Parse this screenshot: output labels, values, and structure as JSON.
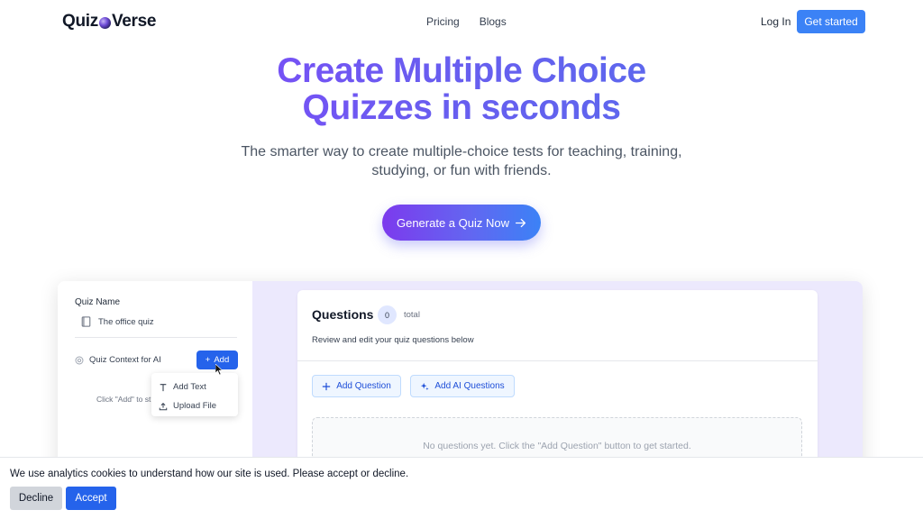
{
  "header": {
    "logo_part1": "Quiz",
    "logo_part2": "Verse",
    "nav": [
      "Pricing",
      "Blogs"
    ],
    "login": "Log In",
    "get_started": "Get started"
  },
  "hero": {
    "title_line1": "Create Multiple Choice",
    "title_line2": "Quizzes in seconds",
    "subtitle_line1": "The smarter way to create multiple-choice tests for teaching, training,",
    "subtitle_line2": "studying, or fun with friends.",
    "cta": "Generate a Quiz Now"
  },
  "preview": {
    "quiz_name_label": "Quiz Name",
    "quiz_name_value": "The office quiz",
    "context_label": "Quiz Context for AI",
    "add_button": "Add",
    "hint": "Click \"Add\" to st",
    "dropdown": [
      "Add Text",
      "Upload File"
    ],
    "questions_title": "Questions",
    "questions_count": "0",
    "total_label": "total",
    "description": "Review and edit your quiz questions below",
    "add_question": "Add Question",
    "add_ai_questions": "Add AI Questions",
    "empty_message": "No questions yet. Click the \"Add Question\" button to get started."
  },
  "cookie": {
    "message": "We use analytics cookies to understand how our site is used. Please accept or decline.",
    "decline": "Decline",
    "accept": "Accept"
  },
  "colors": {
    "accent": "#3b82f6",
    "gradient_start": "#8b3dff",
    "gradient_end": "#4f74ea",
    "panel_bg": "#ece9fd"
  }
}
